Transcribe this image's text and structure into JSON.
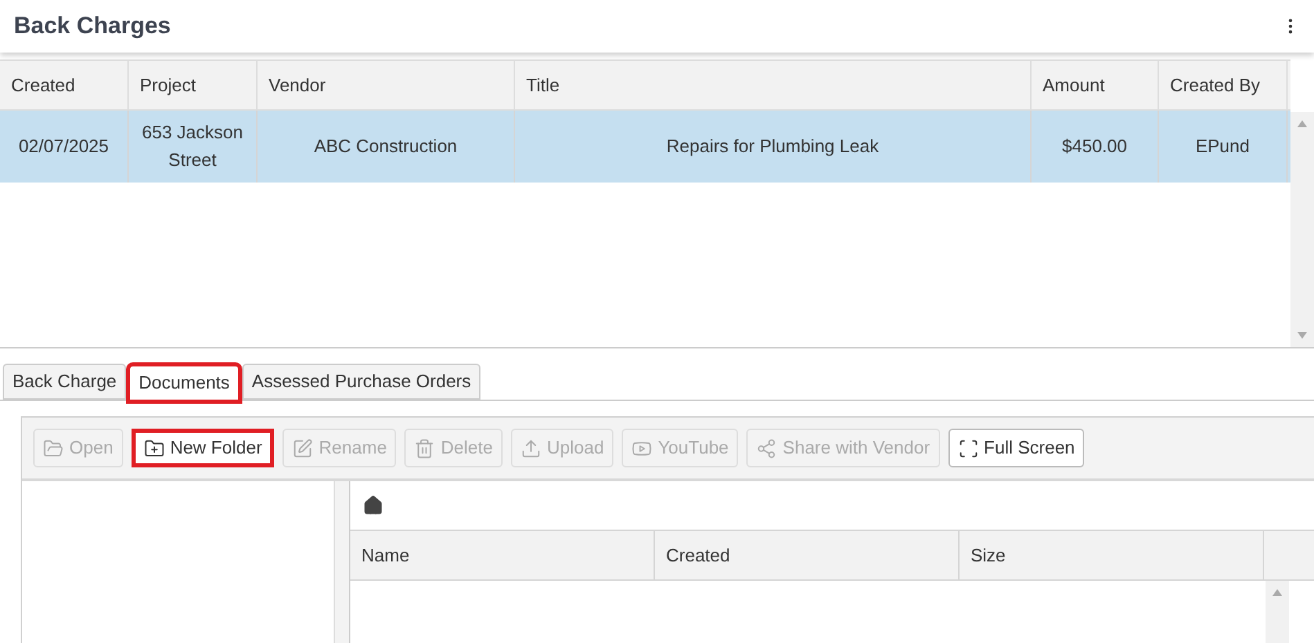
{
  "header": {
    "title": "Back Charges"
  },
  "table": {
    "columns": [
      "Created",
      "Project",
      "Vendor",
      "Title",
      "Amount",
      "Created By"
    ],
    "rows": [
      {
        "selected": true,
        "cells": [
          "02/07/2025",
          "653 Jackson Street",
          "ABC Construction",
          "Repairs for Plumbing Leak",
          "$450.00",
          "EPund"
        ]
      }
    ]
  },
  "tabs": [
    {
      "label": "Back Charge",
      "selected": false,
      "highlighted": false
    },
    {
      "label": "Documents",
      "selected": true,
      "highlighted": true
    },
    {
      "label": "Assessed Purchase Orders",
      "selected": false,
      "highlighted": false
    }
  ],
  "toolbar": [
    {
      "kind": "open",
      "label": "Open",
      "disabled": true,
      "highlighted": false
    },
    {
      "kind": "new-folder",
      "label": "New Folder",
      "disabled": false,
      "highlighted": true
    },
    {
      "kind": "rename",
      "label": "Rename",
      "disabled": true,
      "highlighted": false
    },
    {
      "kind": "delete",
      "label": "Delete",
      "disabled": true,
      "highlighted": false
    },
    {
      "kind": "upload",
      "label": "Upload",
      "disabled": true,
      "highlighted": false
    },
    {
      "kind": "youtube",
      "label": "YouTube",
      "disabled": true,
      "highlighted": false
    },
    {
      "kind": "share",
      "label": "Share with Vendor",
      "disabled": true,
      "highlighted": false
    },
    {
      "kind": "fullscreen",
      "label": "Full Screen",
      "disabled": false,
      "highlighted": false
    }
  ],
  "files": {
    "columns": [
      "Name",
      "Created",
      "Size"
    ]
  }
}
